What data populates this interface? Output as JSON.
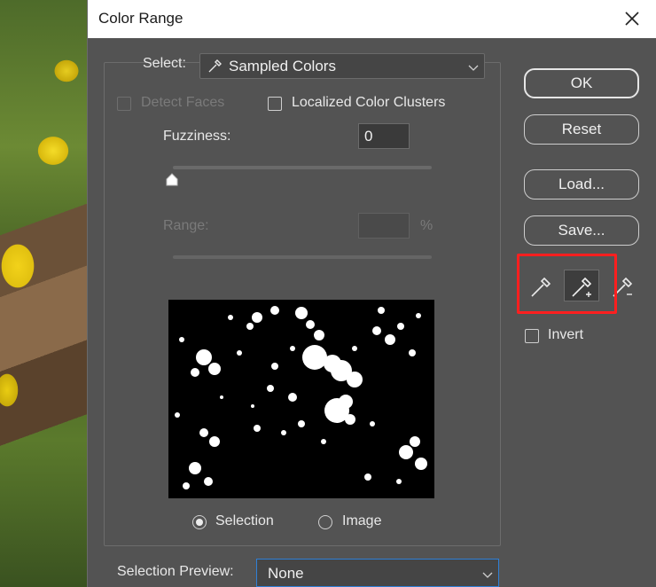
{
  "dialog": {
    "title": "Color Range",
    "select_label": "Select:",
    "select_value": "Sampled Colors",
    "detect_faces_label": "Detect Faces",
    "localized_label": "Localized Color Clusters",
    "fuzziness_label": "Fuzziness:",
    "fuzziness_value": "0",
    "range_label": "Range:",
    "range_unit": "%",
    "radio_selection_label": "Selection",
    "radio_image_label": "Image",
    "selection_preview_label": "Selection Preview:",
    "selection_preview_value": "None"
  },
  "buttons": {
    "ok": "OK",
    "reset": "Reset",
    "load": "Load...",
    "save": "Save..."
  },
  "invert_label": "Invert",
  "icons": {
    "close": "close-icon",
    "eyedropper": "eyedropper-icon",
    "eyedropper_add": "eyedropper-plus-icon",
    "eyedropper_subtract": "eyedropper-minus-icon",
    "chevron": "chevron-down-icon"
  },
  "colors": {
    "dialog_bg": "#535353",
    "highlight": "#ff1f1f",
    "focus_border": "#2f7fd6"
  }
}
